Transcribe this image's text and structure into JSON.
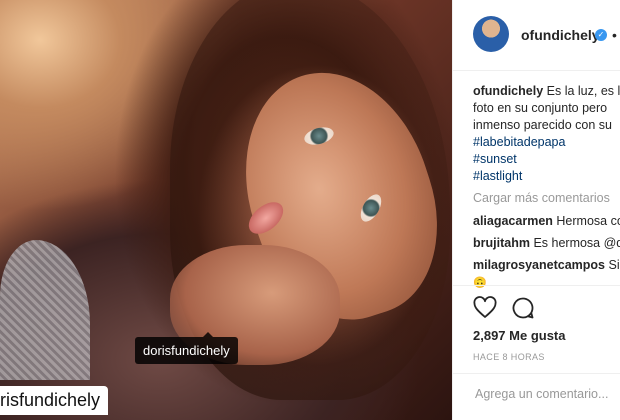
{
  "photo": {
    "tag_label": "dorisfundichely",
    "caption_overlay": "risfundichely"
  },
  "post": {
    "username": "ofundichely",
    "header_separator": "•",
    "verified_symbol": "✓"
  },
  "caption": {
    "user": "ofundichely",
    "line1": "Es la luz, es la",
    "line2": "foto en su conjunto pero",
    "line3": "inmenso parecido con su",
    "hashtags": [
      "#labebitadepapa",
      "#sunset",
      "#lastlight"
    ]
  },
  "comments": {
    "load_more": "Cargar más comentarios",
    "items": [
      {
        "user": "aliagacarmen",
        "text": "Hermosa co"
      },
      {
        "user": "brujitahm",
        "text": "Es hermosa @d"
      },
      {
        "user": "milagrosyanetcampos",
        "text": "Sii"
      }
    ],
    "emoji": "🙃"
  },
  "actions": {
    "like_icon": "heart-icon",
    "comment_icon": "comment-bubble-icon",
    "likes": "2,897 Me gusta",
    "time": "HACE 8 HORAS"
  },
  "add_comment": {
    "placeholder": "Agrega un comentario..."
  },
  "colors": {
    "link": "#003569",
    "muted": "#999999",
    "verified": "#3897f0"
  }
}
